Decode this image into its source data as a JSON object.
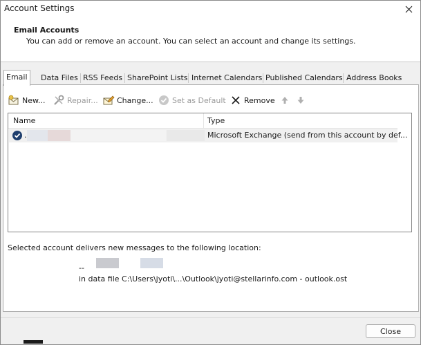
{
  "window": {
    "title": "Account Settings"
  },
  "header": {
    "title": "Email Accounts",
    "description": "You can add or remove an account. You can select an account and change its settings."
  },
  "tabs": [
    {
      "label": "Email",
      "active": true
    },
    {
      "label": "Data Files"
    },
    {
      "label": "RSS Feeds"
    },
    {
      "label": "SharePoint Lists"
    },
    {
      "label": "Internet Calendars"
    },
    {
      "label": "Published Calendars"
    },
    {
      "label": "Address Books"
    }
  ],
  "toolbar": {
    "new_label": "New...",
    "repair_label": "Repair...",
    "change_label": "Change...",
    "set_default_label": "Set as Default",
    "remove_label": "Remove"
  },
  "accounts": {
    "columns": {
      "name": "Name",
      "type": "Type"
    },
    "rows": [
      {
        "name_prefix": ".",
        "type": "Microsoft Exchange (send from this account by def..."
      }
    ]
  },
  "location": {
    "label": "Selected account delivers new messages to the following location:",
    "dash": "--",
    "data_file": "in data file C:\\Users\\jyoti\\...\\Outlook\\jyoti@stellarinfo.com - outlook.ost"
  },
  "footer": {
    "close_label": "Close"
  },
  "colors": {
    "selected_row": "#f0f0f0",
    "check_icon": "#1f3f6e"
  }
}
